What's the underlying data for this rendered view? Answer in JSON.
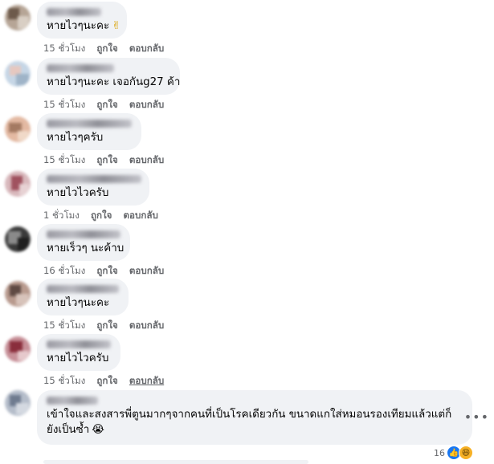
{
  "comments": [
    {
      "text": "หายไวๆนะคะ",
      "emoji": "✌",
      "time": "15 ชั่วโมง",
      "like": "ถูกใจ",
      "reply": "ตอบกลับ",
      "avatar_colors": [
        "#b6a596",
        "#6d5a4b",
        "#d9cfc4"
      ]
    },
    {
      "text": "หายไวๆนะคะ เจอกันg27 ค้า",
      "emoji": "",
      "time": "15 ชั่วโมง",
      "like": "ถูกใจ",
      "reply": "ตอบกลับ",
      "avatar_colors": [
        "#c6d6e6",
        "#e6c8c0",
        "#9fb4c8"
      ]
    },
    {
      "text": "หายไวๆครับ",
      "emoji": "",
      "time": "15 ชั่วโมง",
      "like": "ถูกใจ",
      "reply": "ตอบกลับ",
      "avatar_colors": [
        "#e3b9a2",
        "#a47a62",
        "#f0d9c8"
      ]
    },
    {
      "text": "หายไวไวครับ",
      "emoji": "",
      "time": "1 ชั่วโมง",
      "like": "ถูกใจ",
      "reply": "ตอบกลับ",
      "avatar_colors": [
        "#d8b8bc",
        "#a0525f",
        "#e7d2d4"
      ]
    },
    {
      "text": "หายเร็วๆ นะค้าบ",
      "emoji": "",
      "time": "16 ชั่วโมง",
      "like": "ถูกใจ",
      "reply": "ตอบกลับ",
      "avatar_colors": [
        "#3a3a3a",
        "#8a8a8a",
        "#1f1f1f"
      ]
    },
    {
      "text": "หายไวๆนะคะ",
      "emoji": "",
      "time": "15 ชั่วโมง",
      "like": "ถูกใจ",
      "reply": "ตอบกลับ",
      "avatar_colors": [
        "#b89a8e",
        "#5f4a43",
        "#d7c3ba"
      ]
    },
    {
      "text": "หายไวไวครับ",
      "emoji": "",
      "time": "15 ชั่วโมง",
      "like": "ถูกใจ",
      "reply": "ตอบกลับ",
      "avatar_colors": [
        "#c79098",
        "#8a2e3c",
        "#e6c9cc"
      ]
    },
    {
      "text": "เข้าใจและสงสารพี่ตูนมากๆจากคนที่เป็นโรคเดียวกัน ขนาดแกใส่หมอนรองเทียมแล้วแต่ก็ยังเป็นซ้ำ",
      "emoji": "😭",
      "time": "",
      "like": "",
      "reply": "",
      "avatar_colors": [
        "#b5bdca",
        "#6f7b8f",
        "#d4d9e1"
      ]
    }
  ],
  "last_comment_reaction_count": "16",
  "more_options_icon": "more-horizontal-icon",
  "accent_color": "#1877f2"
}
